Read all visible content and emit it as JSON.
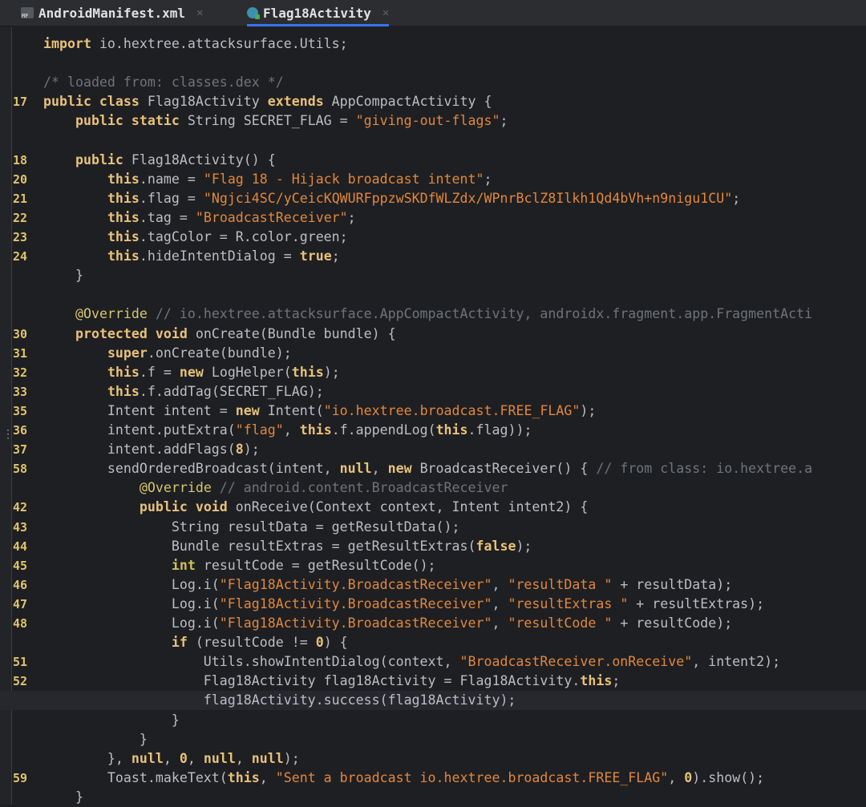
{
  "tabs": [
    {
      "label": "AndroidManifest.xml",
      "icon": "manifest-file-icon",
      "active": false
    },
    {
      "label": "Flag18Activity",
      "icon": "java-class-icon",
      "active": true
    }
  ],
  "code_lines": [
    {
      "num": "",
      "tokens": [
        [
          "kw",
          "import"
        ],
        [
          "t",
          " io.hextree.attacksurface.Utils;"
        ]
      ]
    },
    {
      "num": "",
      "tokens": []
    },
    {
      "num": "",
      "tokens": [
        [
          "cmt",
          "/* loaded from: classes.dex */"
        ]
      ]
    },
    {
      "num": "17",
      "tokens": [
        [
          "kw",
          "public class"
        ],
        [
          "t",
          " Flag18Activity "
        ],
        [
          "kw",
          "extends"
        ],
        [
          "t",
          " AppCompactActivity {"
        ]
      ]
    },
    {
      "num": "",
      "tokens": [
        [
          "t",
          "    "
        ],
        [
          "kw",
          "public static"
        ],
        [
          "t",
          " String SECRET_FLAG = "
        ],
        [
          "str",
          "\"giving-out-flags\""
        ],
        [
          "t",
          ";"
        ]
      ]
    },
    {
      "num": "",
      "tokens": []
    },
    {
      "num": "18",
      "tokens": [
        [
          "t",
          "    "
        ],
        [
          "kw",
          "public"
        ],
        [
          "t",
          " Flag18Activity() {"
        ]
      ]
    },
    {
      "num": "20",
      "tokens": [
        [
          "t",
          "        "
        ],
        [
          "kw",
          "this"
        ],
        [
          "t",
          ".name = "
        ],
        [
          "str",
          "\"Flag 18 - Hijack broadcast intent\""
        ],
        [
          "t",
          ";"
        ]
      ]
    },
    {
      "num": "21",
      "tokens": [
        [
          "t",
          "        "
        ],
        [
          "kw",
          "this"
        ],
        [
          "t",
          ".flag = "
        ],
        [
          "str",
          "\"Ngjci4SC/yCeicKQWURFppzwSKDfWLZdx/WPnrBclZ8Ilkh1Qd4bVh+n9nigu1CU\""
        ],
        [
          "t",
          ";"
        ]
      ]
    },
    {
      "num": "22",
      "tokens": [
        [
          "t",
          "        "
        ],
        [
          "kw",
          "this"
        ],
        [
          "t",
          ".tag = "
        ],
        [
          "str",
          "\"BroadcastReceiver\""
        ],
        [
          "t",
          ";"
        ]
      ]
    },
    {
      "num": "23",
      "tokens": [
        [
          "t",
          "        "
        ],
        [
          "kw",
          "this"
        ],
        [
          "t",
          ".tagColor = R.color.green;"
        ]
      ]
    },
    {
      "num": "24",
      "tokens": [
        [
          "t",
          "        "
        ],
        [
          "kw",
          "this"
        ],
        [
          "t",
          ".hideIntentDialog = "
        ],
        [
          "kw",
          "true"
        ],
        [
          "t",
          ";"
        ]
      ]
    },
    {
      "num": "",
      "tokens": [
        [
          "t",
          "    }"
        ]
      ]
    },
    {
      "num": "",
      "tokens": []
    },
    {
      "num": "",
      "tokens": [
        [
          "t",
          "    "
        ],
        [
          "ann",
          "@Override"
        ],
        [
          "cmt",
          " // io.hextree.attacksurface.AppCompactActivity, androidx.fragment.app.FragmentActi"
        ]
      ]
    },
    {
      "num": "30",
      "tokens": [
        [
          "t",
          "    "
        ],
        [
          "kw",
          "protected void"
        ],
        [
          "t",
          " onCreate(Bundle bundle) {"
        ]
      ]
    },
    {
      "num": "31",
      "tokens": [
        [
          "t",
          "        "
        ],
        [
          "kw",
          "super"
        ],
        [
          "t",
          ".onCreate(bundle);"
        ]
      ]
    },
    {
      "num": "32",
      "tokens": [
        [
          "t",
          "        "
        ],
        [
          "kw",
          "this"
        ],
        [
          "t",
          ".f = "
        ],
        [
          "kw",
          "new"
        ],
        [
          "t",
          " LogHelper("
        ],
        [
          "kw",
          "this"
        ],
        [
          "t",
          ");"
        ]
      ]
    },
    {
      "num": "33",
      "tokens": [
        [
          "t",
          "        "
        ],
        [
          "kw",
          "this"
        ],
        [
          "t",
          ".f.addTag(SECRET_FLAG);"
        ]
      ]
    },
    {
      "num": "35",
      "tokens": [
        [
          "t",
          "        Intent intent = "
        ],
        [
          "kw",
          "new"
        ],
        [
          "t",
          " Intent("
        ],
        [
          "str",
          "\"io.hextree.broadcast.FREE_FLAG\""
        ],
        [
          "t",
          ");"
        ]
      ]
    },
    {
      "num": "36",
      "tokens": [
        [
          "t",
          "        intent.putExtra("
        ],
        [
          "str",
          "\"flag\""
        ],
        [
          "t",
          ", "
        ],
        [
          "kw",
          "this"
        ],
        [
          "t",
          ".f.appendLog("
        ],
        [
          "kw",
          "this"
        ],
        [
          "t",
          ".flag));"
        ]
      ]
    },
    {
      "num": "37",
      "tokens": [
        [
          "t",
          "        intent.addFlags("
        ],
        [
          "num",
          "8"
        ],
        [
          "t",
          ");"
        ]
      ]
    },
    {
      "num": "58",
      "tokens": [
        [
          "t",
          "        sendOrderedBroadcast(intent, "
        ],
        [
          "kw",
          "null"
        ],
        [
          "t",
          ", "
        ],
        [
          "kw",
          "new"
        ],
        [
          "t",
          " BroadcastReceiver() { "
        ],
        [
          "cmt",
          "// from class: io.hextree.a"
        ]
      ]
    },
    {
      "num": "",
      "tokens": [
        [
          "t",
          "            "
        ],
        [
          "ann",
          "@Override"
        ],
        [
          "cmt",
          " // android.content.BroadcastReceiver"
        ]
      ]
    },
    {
      "num": "42",
      "tokens": [
        [
          "t",
          "            "
        ],
        [
          "kw",
          "public void"
        ],
        [
          "t",
          " onReceive(Context context, Intent intent2) {"
        ]
      ]
    },
    {
      "num": "43",
      "tokens": [
        [
          "t",
          "                String resultData = getResultData();"
        ]
      ]
    },
    {
      "num": "44",
      "tokens": [
        [
          "t",
          "                Bundle resultExtras = getResultExtras("
        ],
        [
          "kw",
          "false"
        ],
        [
          "t",
          ");"
        ]
      ]
    },
    {
      "num": "45",
      "tokens": [
        [
          "t",
          "                "
        ],
        [
          "kw2",
          "int"
        ],
        [
          "t",
          " resultCode = getResultCode();"
        ]
      ]
    },
    {
      "num": "46",
      "tokens": [
        [
          "t",
          "                Log.i("
        ],
        [
          "str",
          "\"Flag18Activity.BroadcastReceiver\""
        ],
        [
          "t",
          ", "
        ],
        [
          "str",
          "\"resultData \""
        ],
        [
          "t",
          " + resultData);"
        ]
      ]
    },
    {
      "num": "47",
      "tokens": [
        [
          "t",
          "                Log.i("
        ],
        [
          "str",
          "\"Flag18Activity.BroadcastReceiver\""
        ],
        [
          "t",
          ", "
        ],
        [
          "str",
          "\"resultExtras \""
        ],
        [
          "t",
          " + resultExtras);"
        ]
      ]
    },
    {
      "num": "48",
      "tokens": [
        [
          "t",
          "                Log.i("
        ],
        [
          "str",
          "\"Flag18Activity.BroadcastReceiver\""
        ],
        [
          "t",
          ", "
        ],
        [
          "str",
          "\"resultCode \""
        ],
        [
          "t",
          " + resultCode);"
        ]
      ]
    },
    {
      "num": "",
      "tokens": [
        [
          "t",
          "                "
        ],
        [
          "kw",
          "if"
        ],
        [
          "t",
          " (resultCode != "
        ],
        [
          "num",
          "0"
        ],
        [
          "t",
          ") {"
        ]
      ]
    },
    {
      "num": "51",
      "tokens": [
        [
          "t",
          "                    Utils.showIntentDialog(context, "
        ],
        [
          "str",
          "\"BroadcastReceiver.onReceive\""
        ],
        [
          "t",
          ", intent2);"
        ]
      ]
    },
    {
      "num": "52",
      "tokens": [
        [
          "t",
          "                    Flag18Activity flag18Activity = Flag18Activity."
        ],
        [
          "kw",
          "this"
        ],
        [
          "t",
          ";"
        ]
      ]
    },
    {
      "num": "",
      "tokens": [
        [
          "t",
          "                    flag18Activity.success(flag18Activity);"
        ]
      ],
      "highlight": true
    },
    {
      "num": "",
      "tokens": [
        [
          "t",
          "                }"
        ]
      ]
    },
    {
      "num": "",
      "tokens": [
        [
          "t",
          "            }"
        ]
      ]
    },
    {
      "num": "",
      "tokens": [
        [
          "t",
          "        }, "
        ],
        [
          "kw",
          "null"
        ],
        [
          "t",
          ", "
        ],
        [
          "num",
          "0"
        ],
        [
          "t",
          ", "
        ],
        [
          "kw",
          "null"
        ],
        [
          "t",
          ", "
        ],
        [
          "kw",
          "null"
        ],
        [
          "t",
          ");"
        ]
      ]
    },
    {
      "num": "59",
      "tokens": [
        [
          "t",
          "        Toast.makeText("
        ],
        [
          "kw",
          "this"
        ],
        [
          "t",
          ", "
        ],
        [
          "str",
          "\"Sent a broadcast io.hextree.broadcast.FREE_FLAG\""
        ],
        [
          "t",
          ", "
        ],
        [
          "num",
          "0"
        ],
        [
          "t",
          ").show();"
        ]
      ]
    },
    {
      "num": "",
      "tokens": [
        [
          "t",
          "    }"
        ]
      ]
    }
  ]
}
